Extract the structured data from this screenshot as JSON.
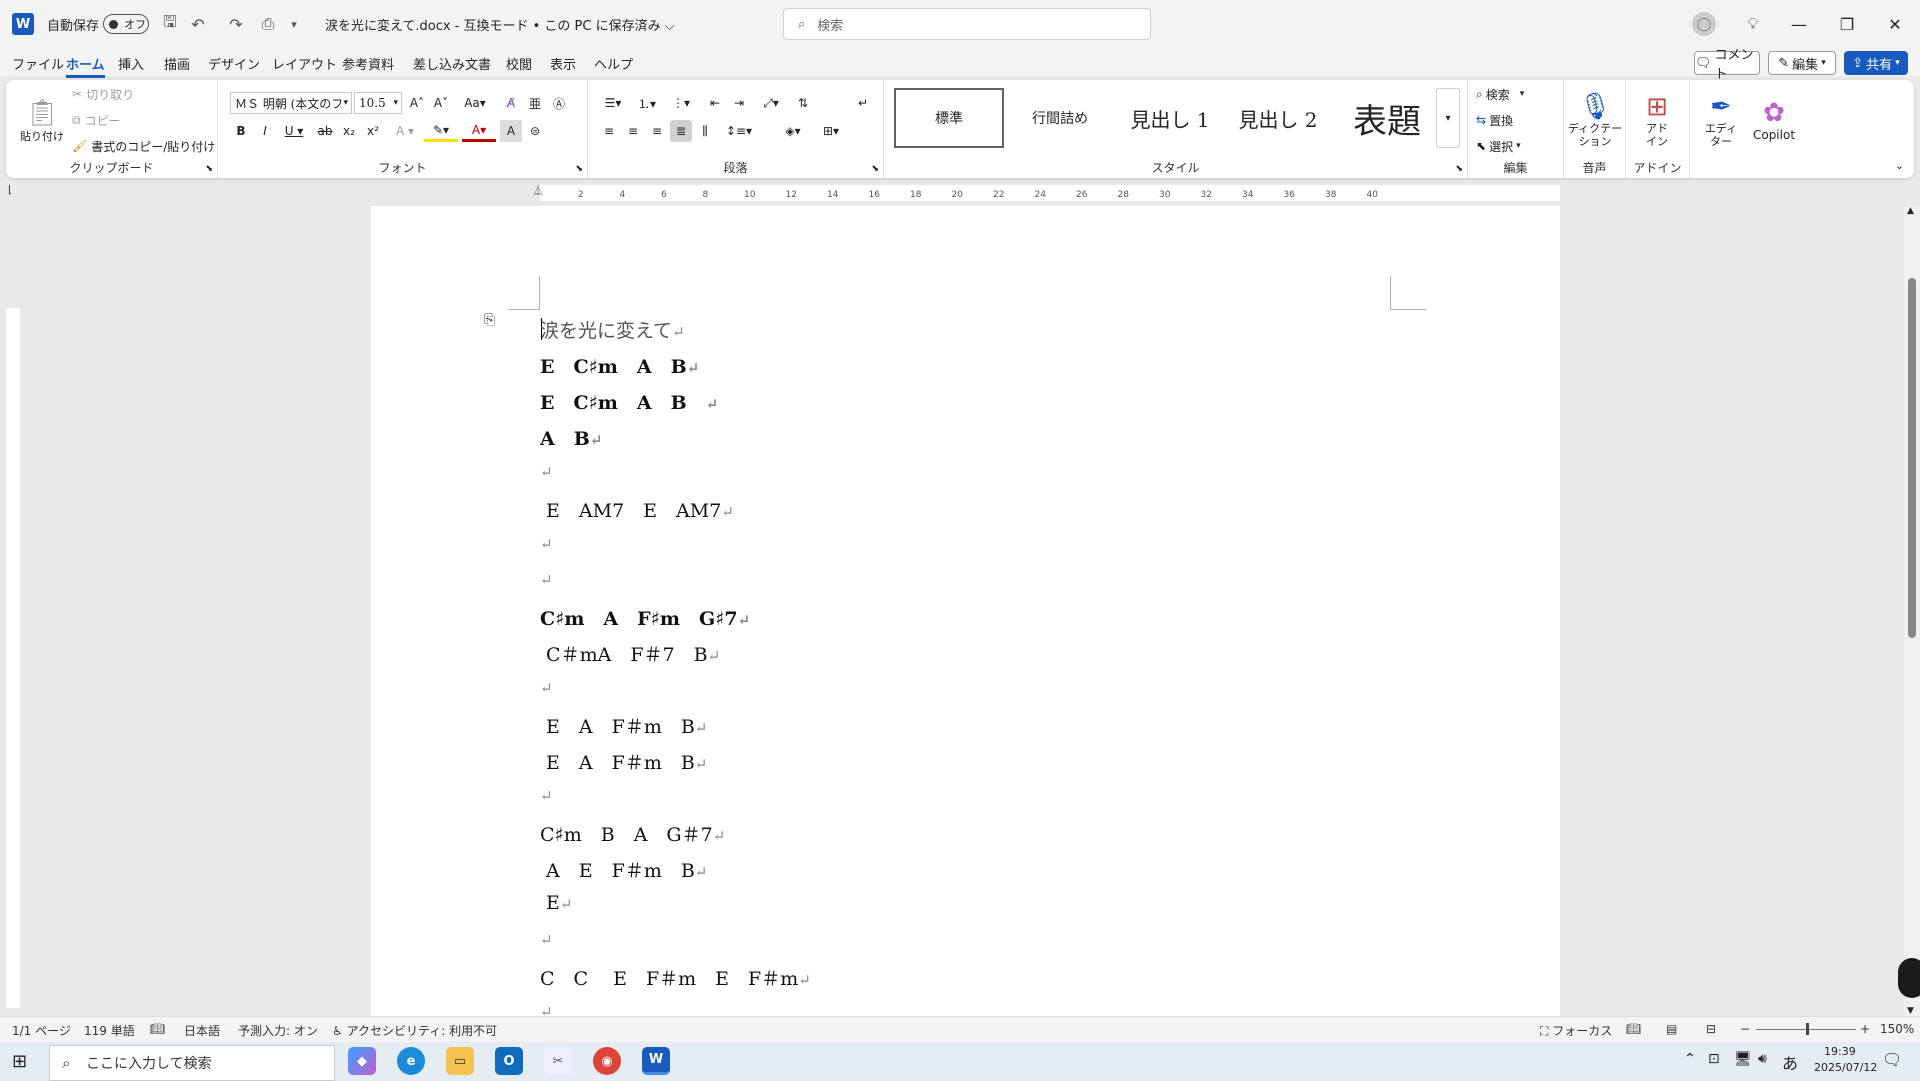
{
  "titlebar": {
    "app_logo": "W",
    "autosave_label": "自動保存",
    "autosave_state": "オフ",
    "document_title": "涙を光に変えて.docx  -  互換モード • この PC に保存済み ⌵",
    "search_placeholder": "検索"
  },
  "menu": {
    "tabs": [
      "ファイル",
      "ホーム",
      "挿入",
      "描画",
      "デザイン",
      "レイアウト",
      "参考資料",
      "差し込み文書",
      "校閲",
      "表示",
      "ヘルプ"
    ],
    "active": "ホーム",
    "comment_label": "コメント",
    "edit_label": "編集",
    "share_label": "共有"
  },
  "ribbon": {
    "clipboard": {
      "paste": "貼り付け",
      "cut": "切り取り",
      "copy": "コピー",
      "format_painter": "書式のコピー/貼り付け",
      "label": "クリップボード"
    },
    "font": {
      "font_name": "ＭＳ 明朝 (本文のフ",
      "font_size": "10.5",
      "label": "フォント"
    },
    "paragraph": {
      "label": "段落"
    },
    "styles": {
      "items": [
        "標準",
        "行間詰め",
        "見出し 1",
        "見出し 2",
        "表題"
      ],
      "label": "スタイル"
    },
    "editing": {
      "find": "検索",
      "replace": "置換",
      "select": "選択",
      "label": "編集"
    },
    "voice": {
      "dictate": "ディクテー\nション",
      "label": "音声"
    },
    "addins": {
      "addin": "アド\nイン",
      "label": "アドイン"
    },
    "editor": "エディ\nター",
    "copilot": "Copilot"
  },
  "document": {
    "lines": [
      {
        "text": "涙を光に変えて",
        "bold": false,
        "light": true
      },
      {
        "text": "E　C♯m　A　B",
        "bold": true
      },
      {
        "text": "E　C♯m　A　B　",
        "bold": true
      },
      {
        "text": "A　B",
        "bold": true
      },
      {
        "text": "",
        "bold": false
      },
      {
        "text": " E　AM7　E　AM7",
        "bold": false
      },
      {
        "text": "",
        "bold": false
      },
      {
        "text": "",
        "bold": false
      },
      {
        "text": "C♯m　A　F♯m　G♯7",
        "bold": true
      },
      {
        "text": " C＃mA　F＃7　B",
        "bold": false
      },
      {
        "text": "",
        "bold": false
      },
      {
        "text": " E　A　F＃m　B",
        "bold": false
      },
      {
        "text": " E　A　F＃m　B",
        "bold": false
      },
      {
        "text": "",
        "bold": false
      },
      {
        "text": "C♯m　B　A　G＃7",
        "bold": false
      },
      {
        "text": " A　E　F＃m　B",
        "bold": false
      },
      {
        "text": " E",
        "bold": false
      },
      {
        "text": "",
        "bold": false
      },
      {
        "text": "C　C　 E　F＃m　E　F＃m",
        "bold": false
      },
      {
        "text": "",
        "bold": false
      }
    ]
  },
  "ruler": {
    "ticks": [
      "2",
      "4",
      "6",
      "8",
      "10",
      "12",
      "14",
      "16",
      "18",
      "20",
      "22",
      "24",
      "26",
      "28",
      "30",
      "32",
      "34",
      "36",
      "38",
      "40"
    ]
  },
  "statusbar": {
    "page": "1/1 ページ",
    "words": "119 単語",
    "language": "日本語",
    "predictive": "予測入力: オン",
    "accessibility": "アクセシビリティ: 利用不可",
    "focus": "フォーカス",
    "zoom": "150%"
  },
  "taskbar": {
    "search_placeholder": "ここに入力して検索",
    "ime": "あ",
    "time": "19:39",
    "date": "2025/07/12"
  },
  "colors": {
    "accent": "#185abd",
    "share": "#185abd",
    "ribbon_bg": "#ffffff",
    "page_bg": "#ffffff"
  }
}
